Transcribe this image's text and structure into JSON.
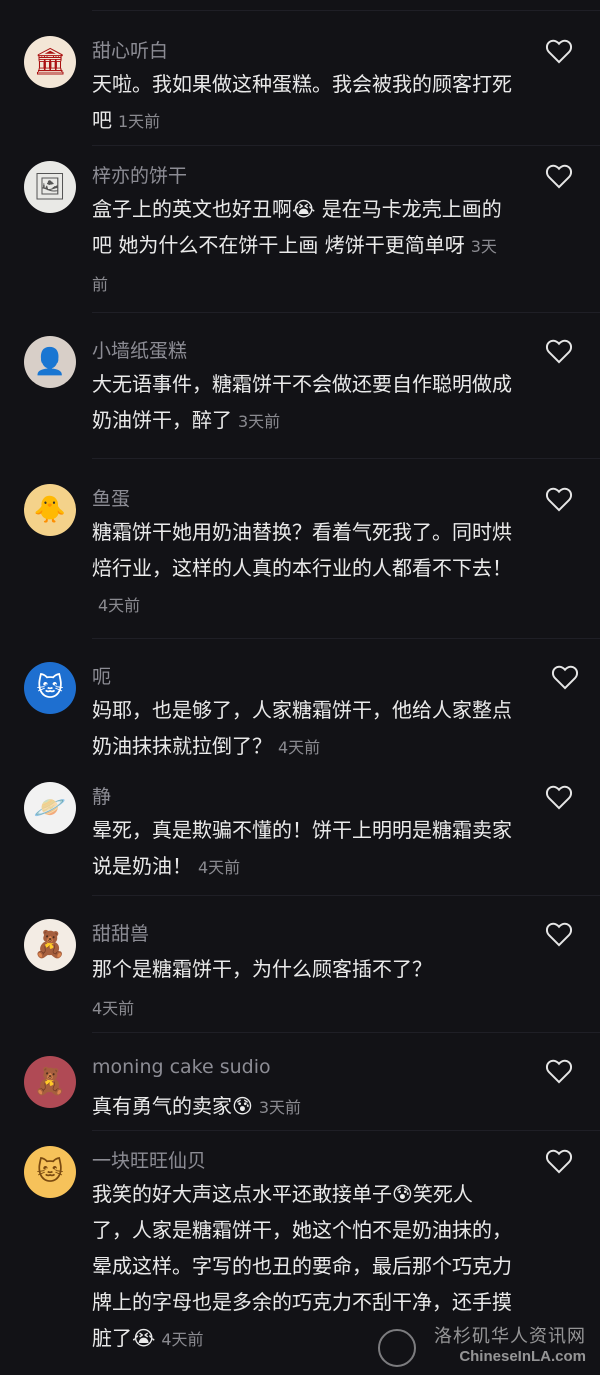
{
  "comments": [
    {
      "username": "甜心听白",
      "text": "天啦。我如果做这种蛋糕。我会被我的顾客打死吧",
      "time": "1天前",
      "avatar_icon": "bakery-logo-avatar",
      "avatar_glyph": "🏛"
    },
    {
      "username": "梓亦的饼干",
      "text_a": "盒子上的英文也好丑啊",
      "emoji": "😭",
      "text_b": " 是在马卡龙壳上画的吧 她为什么不在饼干上画 烤饼干更简单呀",
      "time": "3天前",
      "avatar_icon": "sketch-avatar",
      "avatar_glyph": "🖼"
    },
    {
      "username": "小墙纸蛋糕",
      "text": "大无语事件，糖霜饼干不会做还要自作聪明做成奶油饼干，醉了",
      "time": "3天前",
      "avatar_icon": "person-avatar",
      "avatar_glyph": "👤"
    },
    {
      "username": "鱼蛋",
      "text": "糖霜饼干她用奶油替换？看着气死我了。同时烘焙行业，这样的人真的本行业的人都看不下去！",
      "time": "4天前",
      "avatar_icon": "cartoon-avatar",
      "avatar_glyph": "🐥"
    },
    {
      "username": "呃",
      "text": "妈耶，也是够了，人家糖霜饼干，他给人家整点奶油抹抹就拉倒了？",
      "time": "4天前",
      "avatar_icon": "doraemon-avatar",
      "avatar_glyph": "🐱"
    },
    {
      "username": "静",
      "text": "晕死，真是欺骗不懂的！饼干上明明是糖霜卖家说是奶油！",
      "time": "4天前",
      "avatar_icon": "planet-avatar",
      "avatar_glyph": "🪐"
    },
    {
      "username": "甜甜兽",
      "text": "那个是糖霜饼干，为什么顾客插不了？",
      "time": "4天前",
      "avatar_icon": "cartoon-girl-avatar",
      "avatar_glyph": "🧸"
    },
    {
      "username": "moning cake sudio",
      "text": "真有勇气的卖家",
      "emoji": "😰",
      "time": "3天前",
      "avatar_icon": "bear-avatar",
      "avatar_glyph": "🧸"
    },
    {
      "username": "一块旺旺仙贝",
      "text_a": "我笑的好大声这点水平还敢接单子",
      "emoji": "😰",
      "text_b": "笑死人了，人家是糖霜饼干，她这个怕不是奶油抹的，晕成这样。字写的也丑的要命，最后那个巧克力牌上的字母也是多余的巧克力不刮干净，还手摸脏了",
      "emoji2": "😭",
      "time": "4天前",
      "avatar_icon": "cat-avatar",
      "avatar_glyph": "🐱"
    }
  ],
  "watermark": {
    "line1": "洛杉矶华人资讯网",
    "line2": "ChineseInLA.com"
  },
  "colors": {
    "background": "#121216",
    "username": "#8c8c94",
    "text": "#eaeaea",
    "time": "#8a8a90"
  }
}
